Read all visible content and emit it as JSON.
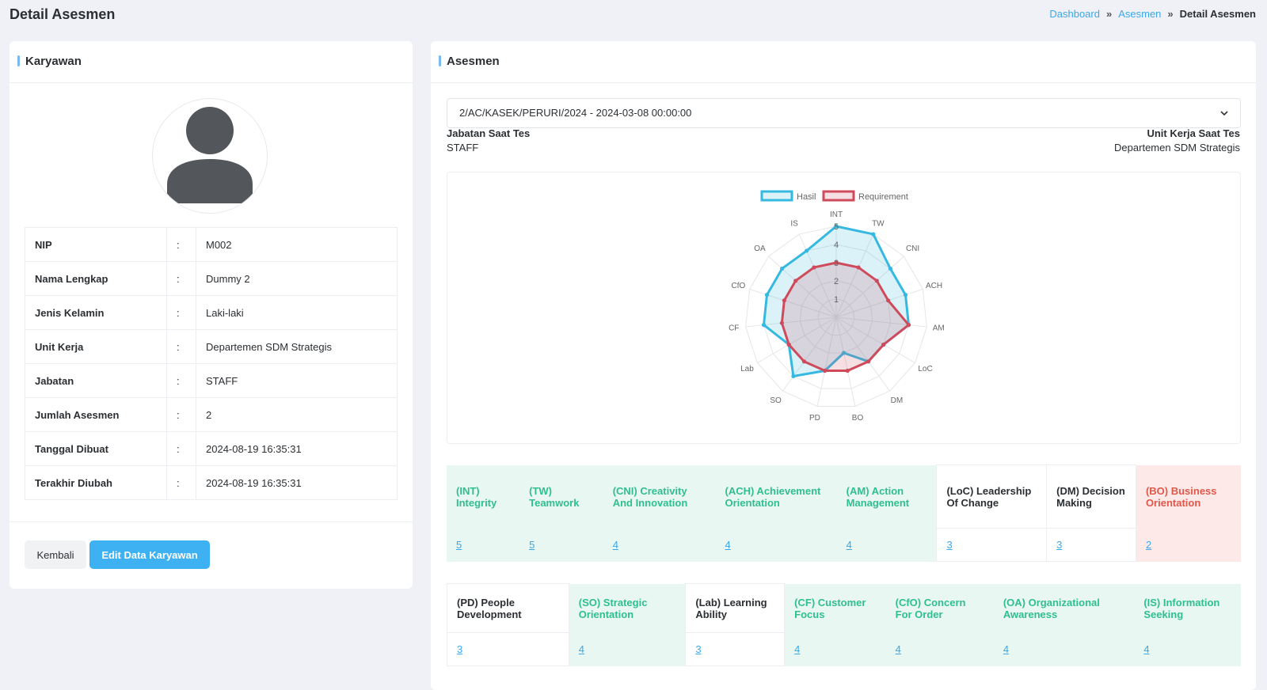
{
  "page": {
    "title": "Detail Asesmen"
  },
  "breadcrumb": {
    "items": [
      "Dashboard",
      "Asesmen"
    ],
    "current": "Detail Asesmen",
    "separator": "»"
  },
  "employee_card": {
    "title": "Karyawan",
    "avatar_icon": "user-avatar-icon",
    "fields": [
      {
        "label": "NIP",
        "value": "M002"
      },
      {
        "label": "Nama Lengkap",
        "value": "Dummy 2"
      },
      {
        "label": "Jenis Kelamin",
        "value": "Laki-laki"
      },
      {
        "label": "Unit Kerja",
        "value": "Departemen SDM Strategis"
      },
      {
        "label": "Jabatan",
        "value": "STAFF"
      },
      {
        "label": "Jumlah Asesmen",
        "value": "2"
      },
      {
        "label": "Tanggal Dibuat",
        "value": "2024-08-19 16:35:31"
      },
      {
        "label": "Terakhir Diubah",
        "value": "2024-08-19 16:35:31"
      }
    ],
    "colon": ":",
    "back_button": "Kembali",
    "edit_button": "Edit Data Karyawan"
  },
  "assessment_card": {
    "title": "Asesmen",
    "select_value": "2/AC/KASEK/PERURI/2024 - 2024-03-08 00:00:00",
    "jabatan_label": "Jabatan Saat Tes",
    "jabatan_value": "STAFF",
    "unit_label": "Unit Kerja Saat Tes",
    "unit_value": "Departemen SDM Strategis"
  },
  "chart_data": {
    "type": "radar",
    "axes": [
      "INT",
      "TW",
      "CNI",
      "ACH",
      "AM",
      "LoC",
      "DM",
      "BO",
      "PD",
      "SO",
      "Lab",
      "CF",
      "CfO",
      "OA",
      "IS"
    ],
    "r_ticks": [
      "1",
      "2",
      "3",
      "4",
      "5"
    ],
    "r_range": [
      0,
      5
    ],
    "legend_placement": "top",
    "series": [
      {
        "name": "Hasil",
        "values": [
          5,
          5,
          4,
          4,
          4,
          3,
          3,
          2,
          3,
          4,
          3,
          4,
          4,
          4,
          4
        ],
        "color": "#36b9e0"
      },
      {
        "name": "Requirement",
        "values": [
          3,
          3,
          3,
          3,
          4,
          3,
          3,
          3,
          3,
          3,
          3,
          3,
          3,
          3,
          3
        ],
        "color": "#cf4b5c"
      }
    ]
  },
  "competency_rows": [
    [
      {
        "label": "(INT) Integrity",
        "score": "5",
        "status": "above"
      },
      {
        "label": "(TW) Teamwork",
        "score": "5",
        "status": "above"
      },
      {
        "label": "(CNI) Creativity And Innovation",
        "score": "4",
        "status": "above"
      },
      {
        "label": "(ACH) Achievement Orientation",
        "score": "4",
        "status": "above"
      },
      {
        "label": "(AM) Action Management",
        "score": "4",
        "status": "above"
      },
      {
        "label": "(LoC) Leadership Of Change",
        "score": "3",
        "status": "meet"
      },
      {
        "label": "(DM) Decision Making",
        "score": "3",
        "status": "meet"
      },
      {
        "label": "(BO) Business Orientation",
        "score": "2",
        "status": "below"
      }
    ],
    [
      {
        "label": "(PD) People Development",
        "score": "3",
        "status": "meet"
      },
      {
        "label": "(SO) Strategic Orientation",
        "score": "4",
        "status": "above"
      },
      {
        "label": "(Lab) Learning Ability",
        "score": "3",
        "status": "meet"
      },
      {
        "label": "(CF) Customer Focus",
        "score": "4",
        "status": "above"
      },
      {
        "label": "(CfO) Concern For Order",
        "score": "4",
        "status": "above"
      },
      {
        "label": "(OA) Organizational Awareness",
        "score": "4",
        "status": "above"
      },
      {
        "label": "(IS) Information Seeking",
        "score": "4",
        "status": "above"
      }
    ]
  ],
  "colors": {
    "above_bg": "#e8f7f1",
    "above_text": "#2fbf8f",
    "meet_bg": "#ffffff",
    "meet_text": "#2b2f33",
    "below_bg": "#fde9e7",
    "below_text": "#e0584a",
    "accent": "#3db1f2"
  }
}
